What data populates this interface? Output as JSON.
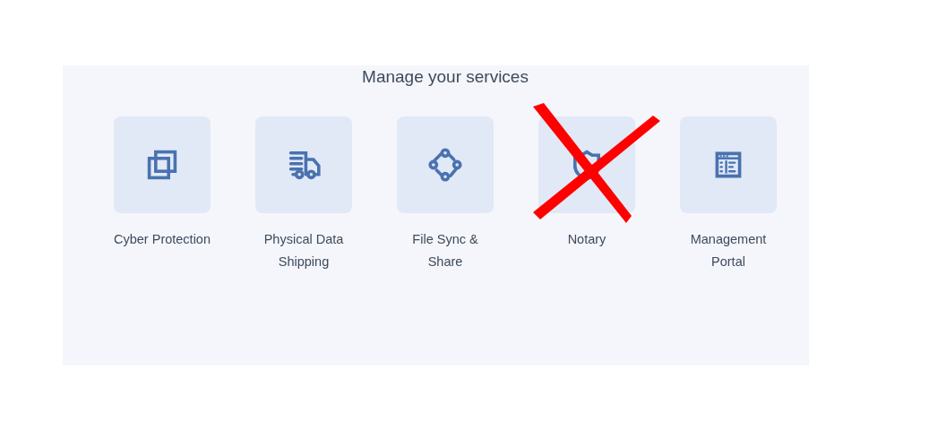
{
  "title": "Manage your services",
  "services": [
    {
      "kind": "squares",
      "label": "Cyber Protection",
      "crossed_out": false
    },
    {
      "kind": "truck",
      "label": "Physical Data Shipping",
      "crossed_out": false
    },
    {
      "kind": "sync",
      "label": "File Sync & Share",
      "crossed_out": false
    },
    {
      "kind": "shield",
      "label": "Notary",
      "crossed_out": true
    },
    {
      "kind": "portal",
      "label": "Management Portal",
      "crossed_out": false
    }
  ]
}
